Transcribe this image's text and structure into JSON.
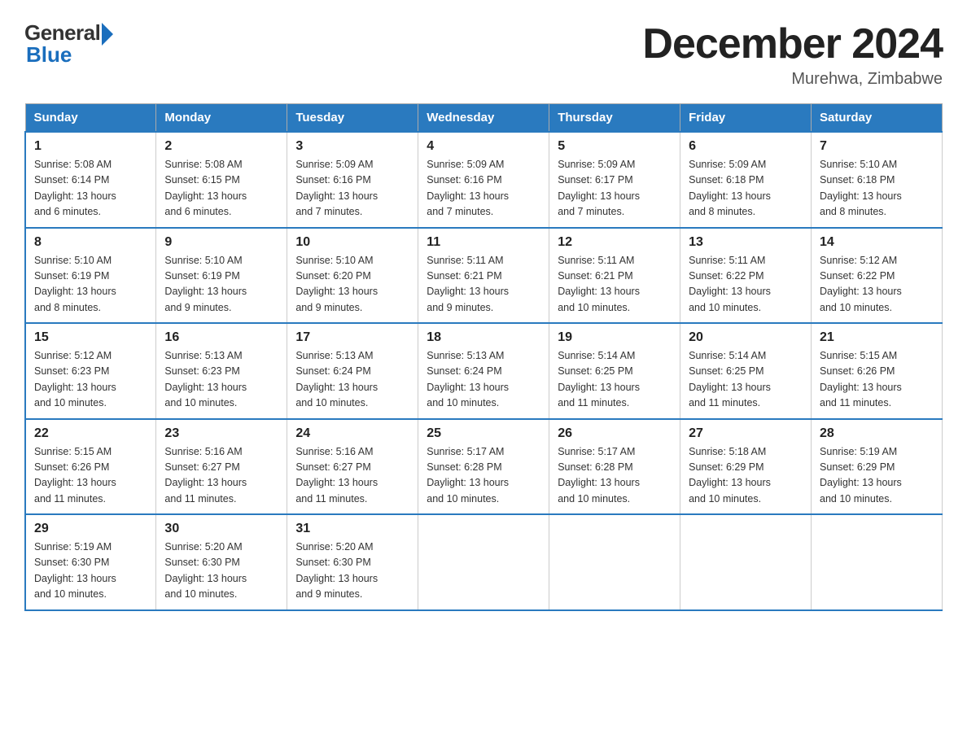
{
  "header": {
    "logo_general": "General",
    "logo_blue": "Blue",
    "month_title": "December 2024",
    "location": "Murehwa, Zimbabwe"
  },
  "days_of_week": [
    "Sunday",
    "Monday",
    "Tuesday",
    "Wednesday",
    "Thursday",
    "Friday",
    "Saturday"
  ],
  "weeks": [
    [
      {
        "num": "1",
        "sunrise": "5:08 AM",
        "sunset": "6:14 PM",
        "daylight": "13 hours and 6 minutes."
      },
      {
        "num": "2",
        "sunrise": "5:08 AM",
        "sunset": "6:15 PM",
        "daylight": "13 hours and 6 minutes."
      },
      {
        "num": "3",
        "sunrise": "5:09 AM",
        "sunset": "6:16 PM",
        "daylight": "13 hours and 7 minutes."
      },
      {
        "num": "4",
        "sunrise": "5:09 AM",
        "sunset": "6:16 PM",
        "daylight": "13 hours and 7 minutes."
      },
      {
        "num": "5",
        "sunrise": "5:09 AM",
        "sunset": "6:17 PM",
        "daylight": "13 hours and 7 minutes."
      },
      {
        "num": "6",
        "sunrise": "5:09 AM",
        "sunset": "6:18 PM",
        "daylight": "13 hours and 8 minutes."
      },
      {
        "num": "7",
        "sunrise": "5:10 AM",
        "sunset": "6:18 PM",
        "daylight": "13 hours and 8 minutes."
      }
    ],
    [
      {
        "num": "8",
        "sunrise": "5:10 AM",
        "sunset": "6:19 PM",
        "daylight": "13 hours and 8 minutes."
      },
      {
        "num": "9",
        "sunrise": "5:10 AM",
        "sunset": "6:19 PM",
        "daylight": "13 hours and 9 minutes."
      },
      {
        "num": "10",
        "sunrise": "5:10 AM",
        "sunset": "6:20 PM",
        "daylight": "13 hours and 9 minutes."
      },
      {
        "num": "11",
        "sunrise": "5:11 AM",
        "sunset": "6:21 PM",
        "daylight": "13 hours and 9 minutes."
      },
      {
        "num": "12",
        "sunrise": "5:11 AM",
        "sunset": "6:21 PM",
        "daylight": "13 hours and 10 minutes."
      },
      {
        "num": "13",
        "sunrise": "5:11 AM",
        "sunset": "6:22 PM",
        "daylight": "13 hours and 10 minutes."
      },
      {
        "num": "14",
        "sunrise": "5:12 AM",
        "sunset": "6:22 PM",
        "daylight": "13 hours and 10 minutes."
      }
    ],
    [
      {
        "num": "15",
        "sunrise": "5:12 AM",
        "sunset": "6:23 PM",
        "daylight": "13 hours and 10 minutes."
      },
      {
        "num": "16",
        "sunrise": "5:13 AM",
        "sunset": "6:23 PM",
        "daylight": "13 hours and 10 minutes."
      },
      {
        "num": "17",
        "sunrise": "5:13 AM",
        "sunset": "6:24 PM",
        "daylight": "13 hours and 10 minutes."
      },
      {
        "num": "18",
        "sunrise": "5:13 AM",
        "sunset": "6:24 PM",
        "daylight": "13 hours and 10 minutes."
      },
      {
        "num": "19",
        "sunrise": "5:14 AM",
        "sunset": "6:25 PM",
        "daylight": "13 hours and 11 minutes."
      },
      {
        "num": "20",
        "sunrise": "5:14 AM",
        "sunset": "6:25 PM",
        "daylight": "13 hours and 11 minutes."
      },
      {
        "num": "21",
        "sunrise": "5:15 AM",
        "sunset": "6:26 PM",
        "daylight": "13 hours and 11 minutes."
      }
    ],
    [
      {
        "num": "22",
        "sunrise": "5:15 AM",
        "sunset": "6:26 PM",
        "daylight": "13 hours and 11 minutes."
      },
      {
        "num": "23",
        "sunrise": "5:16 AM",
        "sunset": "6:27 PM",
        "daylight": "13 hours and 11 minutes."
      },
      {
        "num": "24",
        "sunrise": "5:16 AM",
        "sunset": "6:27 PM",
        "daylight": "13 hours and 11 minutes."
      },
      {
        "num": "25",
        "sunrise": "5:17 AM",
        "sunset": "6:28 PM",
        "daylight": "13 hours and 10 minutes."
      },
      {
        "num": "26",
        "sunrise": "5:17 AM",
        "sunset": "6:28 PM",
        "daylight": "13 hours and 10 minutes."
      },
      {
        "num": "27",
        "sunrise": "5:18 AM",
        "sunset": "6:29 PM",
        "daylight": "13 hours and 10 minutes."
      },
      {
        "num": "28",
        "sunrise": "5:19 AM",
        "sunset": "6:29 PM",
        "daylight": "13 hours and 10 minutes."
      }
    ],
    [
      {
        "num": "29",
        "sunrise": "5:19 AM",
        "sunset": "6:30 PM",
        "daylight": "13 hours and 10 minutes."
      },
      {
        "num": "30",
        "sunrise": "5:20 AM",
        "sunset": "6:30 PM",
        "daylight": "13 hours and 10 minutes."
      },
      {
        "num": "31",
        "sunrise": "5:20 AM",
        "sunset": "6:30 PM",
        "daylight": "13 hours and 9 minutes."
      },
      null,
      null,
      null,
      null
    ]
  ],
  "labels": {
    "sunrise": "Sunrise:",
    "sunset": "Sunset:",
    "daylight": "Daylight:"
  }
}
